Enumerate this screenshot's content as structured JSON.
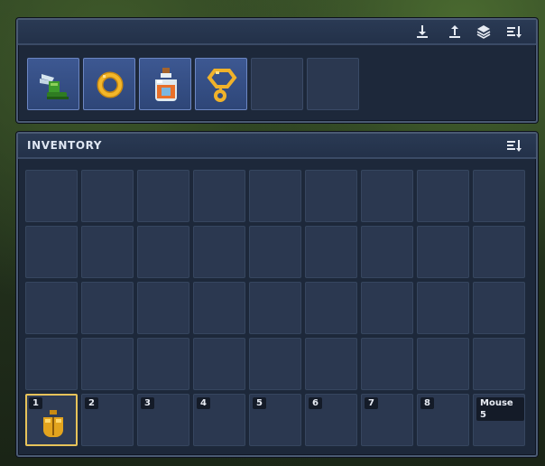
{
  "equipment_bar": {
    "actions": [
      {
        "icon": "download-icon",
        "label": "Deposit"
      },
      {
        "icon": "upload-icon",
        "label": "Take"
      },
      {
        "icon": "layers-icon",
        "label": "Stack"
      },
      {
        "icon": "sort-icon",
        "label": "Sort"
      }
    ],
    "slots": [
      {
        "item": "winged-boots-icon",
        "filled": true
      },
      {
        "item": "gold-ring-icon",
        "filled": true
      },
      {
        "item": "potion-icon",
        "filled": true
      },
      {
        "item": "gold-amulet-icon",
        "filled": true
      },
      {
        "item": "",
        "filled": false
      },
      {
        "item": "",
        "filled": false
      }
    ]
  },
  "inventory": {
    "title": "INVENTORY",
    "sort_icon": "sort-icon",
    "rows": 4,
    "columns": 9,
    "hotbar": [
      {
        "label": "1",
        "item": "golden-scarab-icon",
        "selected": true
      },
      {
        "label": "2",
        "item": "",
        "selected": false
      },
      {
        "label": "3",
        "item": "",
        "selected": false
      },
      {
        "label": "4",
        "item": "",
        "selected": false
      },
      {
        "label": "5",
        "item": "",
        "selected": false
      },
      {
        "label": "6",
        "item": "",
        "selected": false
      },
      {
        "label": "7",
        "item": "",
        "selected": false
      },
      {
        "label": "8",
        "item": "",
        "selected": false
      },
      {
        "label": "Mouse 5",
        "item": "",
        "selected": false
      }
    ]
  },
  "colors": {
    "panel": "#1d283a",
    "slot": "#2b3850",
    "slot_filled": "#3d5892",
    "selected_border": "#e7c35a"
  }
}
